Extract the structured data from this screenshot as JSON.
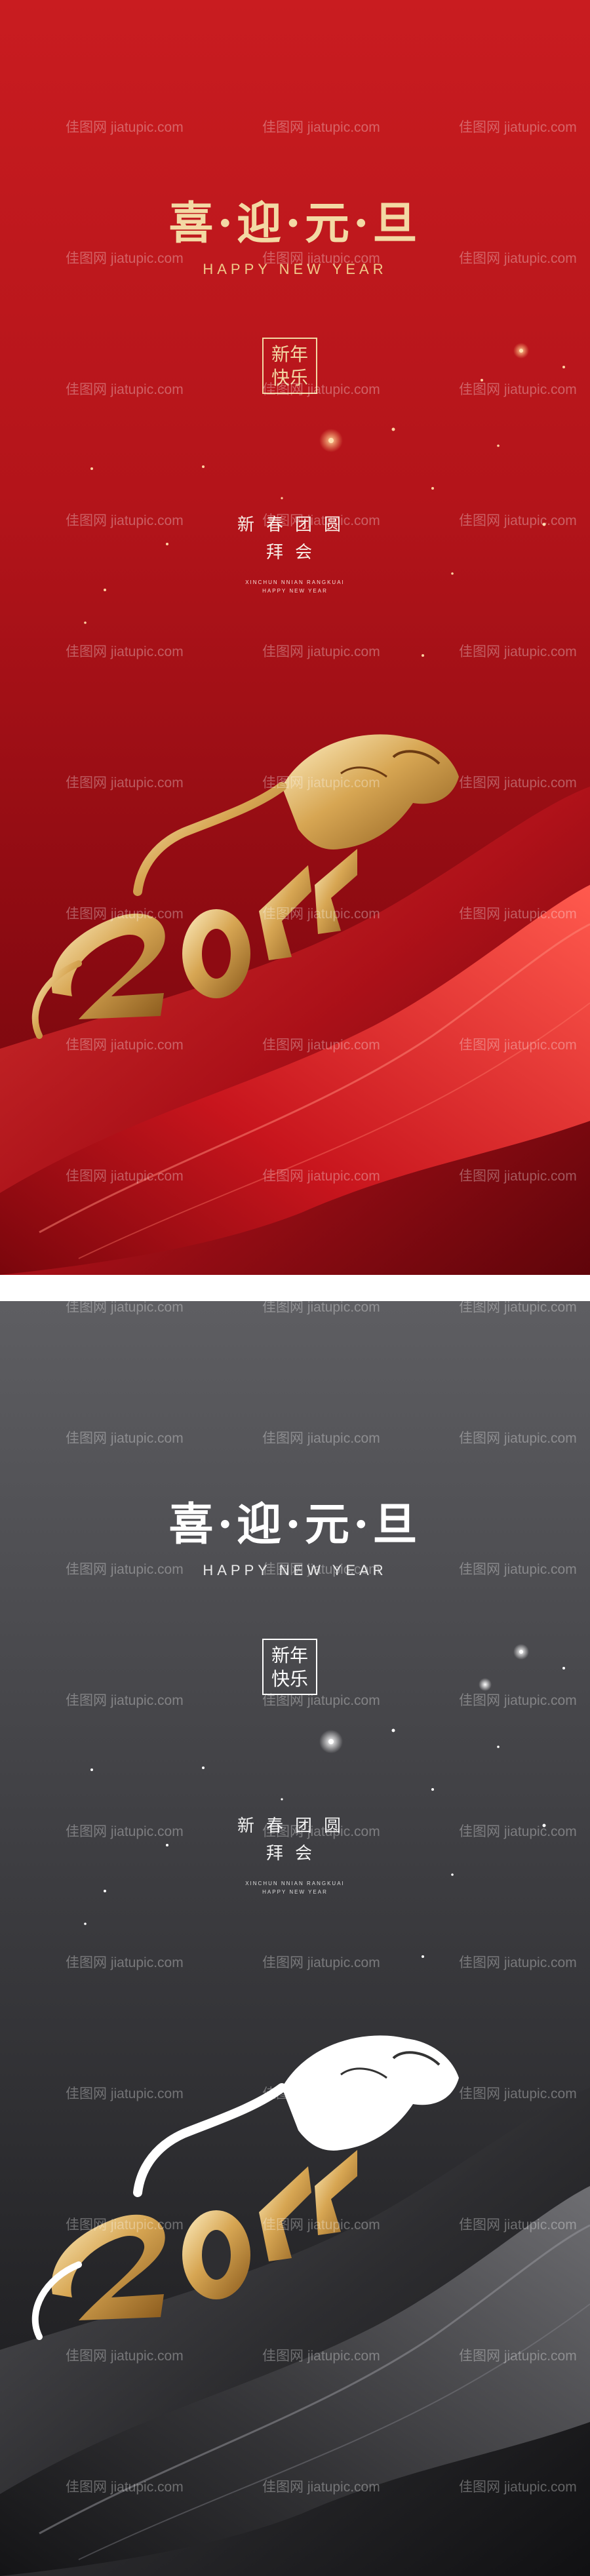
{
  "posters": [
    {
      "title": "喜·迎·元·旦",
      "subtitle": "HAPPY NEW YEAR",
      "seal": [
        "新年",
        "快乐"
      ],
      "event_lines": [
        "新春团圆",
        "拜会"
      ],
      "event_small_lines": [
        "XINCHUN NNIAN RANGKUAI",
        "HAPPY NEW YEAR"
      ],
      "theme": {
        "background": "#b3141a",
        "accent": "#f3d9a4",
        "ribbon": "#d41f25"
      }
    },
    {
      "title": "喜·迎·元·旦",
      "subtitle": "HAPPY NEW YEAR",
      "seal": [
        "新年",
        "快乐"
      ],
      "event_lines": [
        "新春团圆",
        "拜会"
      ],
      "event_small_lines": [
        "XINCHUN NNIAN RANGKUAI",
        "HAPPY NEW YEAR"
      ],
      "theme": {
        "background": "#3f3f43",
        "accent": "#ffffff",
        "ribbon": "#2a2a2d"
      }
    }
  ],
  "artwork": {
    "number": "2022",
    "animal": "tiger-icon"
  },
  "watermark": {
    "cn": "佳图网",
    "url": "jiatupic.com"
  }
}
